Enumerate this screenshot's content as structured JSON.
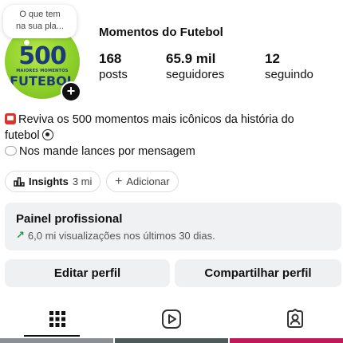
{
  "note": {
    "line1": "O que tem",
    "line2": "na sua pla..."
  },
  "avatar": {
    "number": "500",
    "subtitle": "MAIORES MOMENTOS",
    "word": "FUTEBOL",
    "add_label": "+"
  },
  "profile": {
    "name": "Momentos do Futebol",
    "stats": [
      {
        "value": "168",
        "label": "posts"
      },
      {
        "value": "65.9 mil",
        "label": "seguidores"
      },
      {
        "value": "12",
        "label": "seguindo"
      }
    ]
  },
  "bio": {
    "line1": "Reviva os 500 momentos mais icônicos da história do",
    "line2": "futebol",
    "line3": "Nos mande lances por mensagem"
  },
  "chips": {
    "insights_label": "Insights",
    "insights_value": "3 mi",
    "add_label": "Adicionar"
  },
  "panel": {
    "title": "Painel profissional",
    "subtitle": "6,0 mi visualizações nos últimos 30 dias."
  },
  "buttons": {
    "edit": "Editar perfil",
    "share": "Compartilhar perfil"
  },
  "tabs": [
    "grid-tab",
    "reels-tab",
    "tagged-tab"
  ],
  "colors": {
    "panel_bg": "#f0f1f3",
    "button_bg": "#eef0f2",
    "growth_green": "#1c9a4a",
    "avatar_green": "#8fd12a",
    "avatar_text": "#1c3a77"
  }
}
